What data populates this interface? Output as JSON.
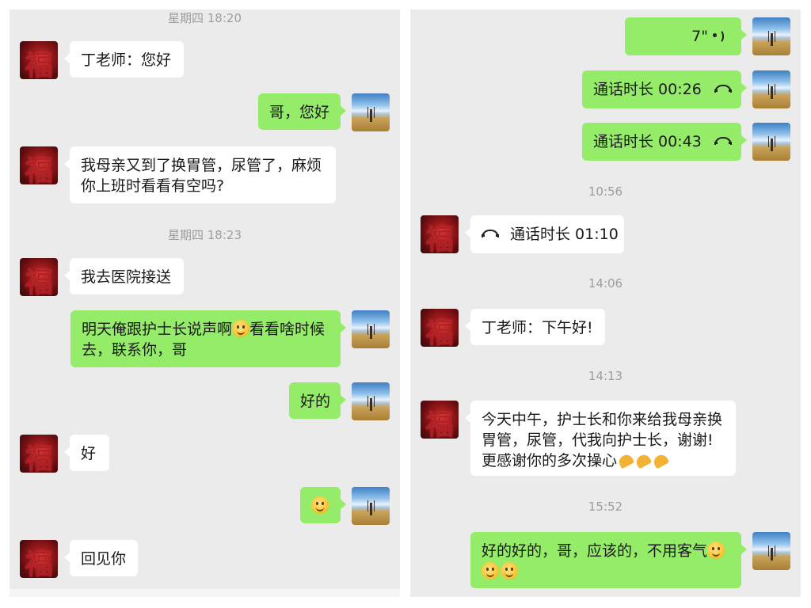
{
  "left": {
    "ts1": "星期四 18:20",
    "m1": "丁老师：您好",
    "m2": "哥，您好",
    "m3_line1": "我母亲又到了换胃管，尿管了，麻烦",
    "m3_line2": "你上班时看看有空吗?",
    "ts2": "星期四 18:23",
    "m4": "我去医院接送",
    "m5_part1": "明天俺跟护士长说声啊",
    "m5_part2": "看看啥时候",
    "m5_line2": "去，联系你，哥",
    "m6": "好的",
    "m7": "好",
    "m9": "回见你"
  },
  "right": {
    "voice_duration": "7\"",
    "call1": "通话时长 00:26",
    "call2": "通话时长 00:43",
    "ts1": "10:56",
    "call3": "通话时长 01:10",
    "ts2": "14:06",
    "m1": "丁老师：下午好!",
    "ts3": "14:13",
    "m2_line1": "今天中午，护士长和你来给我母亲换",
    "m2_line2": "胃管，尿管，代我向护士长，谢谢!",
    "m2_line3": "更感谢你的多次操心",
    "ts4": "15:52",
    "m3_line1": "好的好的，哥，应该的，不用客气"
  },
  "icons": {
    "received_avatar": "fu-character-avatar",
    "sent_avatar": "sky-landscape-avatar",
    "emoji": "smile-emoji",
    "pray": "pray-hands-emoji",
    "call": "phone-hangup-icon",
    "voice": "voice-wave-icon"
  },
  "colors": {
    "chat_bg": "#ebebeb",
    "sent_bubble": "#95ec69",
    "received_bubble": "#ffffff",
    "timestamp": "#9d9d9d"
  }
}
